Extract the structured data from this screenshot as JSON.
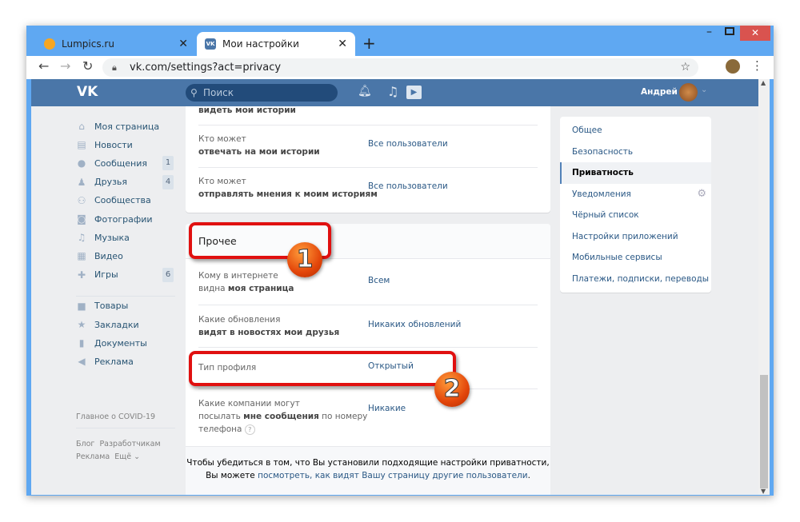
{
  "browser": {
    "tabs": [
      {
        "title": "Lumpics.ru",
        "icon": "orange-icon"
      },
      {
        "title": "Мои настройки",
        "icon": "vk-icon"
      }
    ],
    "url": "vk.com/settings?act=privacy"
  },
  "header": {
    "logo": "VK",
    "search_placeholder": "Поиск",
    "user_name": "Андрей",
    "color": "#4a76a8"
  },
  "sidebar": {
    "items": [
      {
        "label": "Моя страница",
        "icon": "home-icon",
        "glyph": "⌂"
      },
      {
        "label": "Новости",
        "icon": "news-icon",
        "glyph": "▤"
      },
      {
        "label": "Сообщения",
        "icon": "messages-icon",
        "glyph": "●",
        "badge": "1"
      },
      {
        "label": "Друзья",
        "icon": "friends-icon",
        "glyph": "♟",
        "badge": "4"
      },
      {
        "label": "Сообщества",
        "icon": "groups-icon",
        "glyph": "⚇"
      },
      {
        "label": "Фотографии",
        "icon": "camera-icon",
        "glyph": "◙"
      },
      {
        "label": "Музыка",
        "icon": "music-icon",
        "glyph": "♫"
      },
      {
        "label": "Видео",
        "icon": "video-icon",
        "glyph": "▦"
      },
      {
        "label": "Игры",
        "icon": "games-icon",
        "glyph": "✚",
        "badge": "6"
      },
      {
        "label": "Товары",
        "icon": "bag-icon",
        "glyph": "■"
      },
      {
        "label": "Закладки",
        "icon": "star-icon",
        "glyph": "★"
      },
      {
        "label": "Документы",
        "icon": "document-icon",
        "glyph": "▮"
      },
      {
        "label": "Реклама",
        "icon": "megaphone-icon",
        "glyph": "◀"
      }
    ],
    "covid": "Главное о COVID-19",
    "footer": [
      "Блог",
      "Разработчикам",
      "Реклама",
      "Ещё ⌄"
    ]
  },
  "stories": {
    "partial": "видеть мои истории",
    "rows": [
      {
        "l1": "Кто может",
        "l2": "отвечать на мои истории",
        "value": "Все пользователи"
      },
      {
        "l1": "Кто может",
        "l2": "отправлять мнения к моим историям",
        "value": "Все пользователи"
      }
    ]
  },
  "other": {
    "title": "Прочее",
    "rows": [
      {
        "l1": "Кому в интернете",
        "l2a": "видна ",
        "l2b": "моя страница",
        "value": "Всем"
      },
      {
        "l1": "Какие обновления",
        "l2": "видят в новостях мои друзья",
        "value": "Никаких обновлений"
      },
      {
        "l1": "Тип профиля",
        "value": "Открытый"
      },
      {
        "l1": "Какие компании могут",
        "l2a": "посылать ",
        "l2b": "мне сообщения",
        "l2c": " по номеру",
        "l3": "телефона",
        "value": "Никакие"
      }
    ],
    "footer1": "Чтобы убедиться в том, что Вы установили подходящие настройки приватности,",
    "footer2": "Вы можете ",
    "footer_link": "посмотреть, как видят Вашу страницу другие пользователи",
    "footer_end": "."
  },
  "settings_menu": {
    "items": [
      "Общее",
      "Безопасность",
      "Приватность",
      "Уведомления",
      "Чёрный список",
      "Настройки приложений",
      "Мобильные сервисы",
      "Платежи, подписки, переводы"
    ],
    "active": "Приватность"
  },
  "annotations": [
    "1",
    "2"
  ]
}
